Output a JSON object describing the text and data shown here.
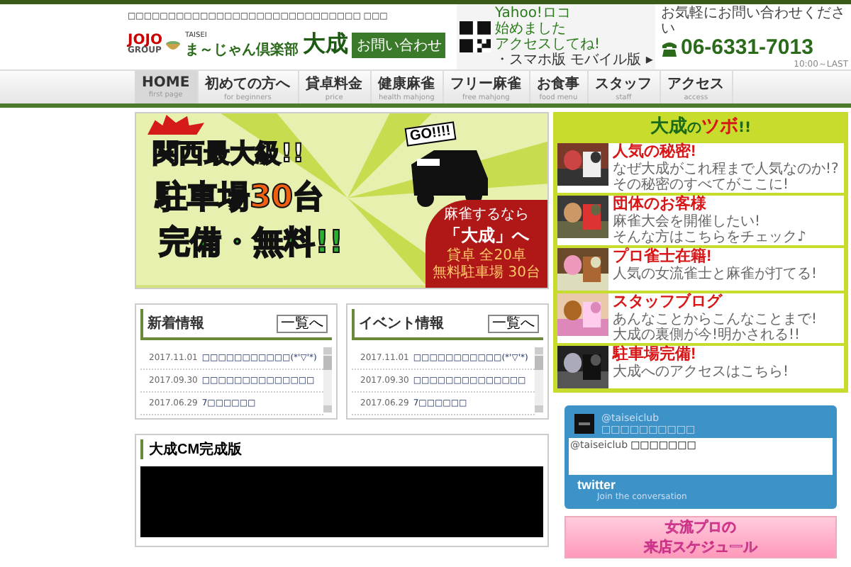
{
  "header": {
    "top_text": "□□□□□□□□□□□□□□□□□□□□□□□□□□□□□ □□□",
    "logo": "JOJO",
    "logo_sub": "GROUP",
    "brand_small": "TAISEI",
    "brand": "ま～じゃん倶楽部",
    "brand_big": "大成",
    "contact_button": "お問い合わせ",
    "yahoo_lines": [
      "Yahoo!ロコ",
      "始めました",
      "アクセスしてね!"
    ],
    "mobile_link": "・スマホ版 モバイル版 ▸",
    "phone_note": "お気軽にお問い合わせください",
    "phone": "06-6331-7013",
    "hours": "10:00～LAST"
  },
  "nav": [
    {
      "label": "HOME",
      "sub": "first page",
      "selected": true
    },
    {
      "label": "初めての方へ",
      "sub": "for beginners",
      "selected": false
    },
    {
      "label": "貸卓料金",
      "sub": "price",
      "selected": false
    },
    {
      "label": "健康麻雀",
      "sub": "health mahjong",
      "selected": false
    },
    {
      "label": "フリー麻雀",
      "sub": "free mahjong",
      "selected": false
    },
    {
      "label": "お食事",
      "sub": "food menu",
      "selected": false
    },
    {
      "label": "スタッフ",
      "sub": "staff",
      "selected": false
    },
    {
      "label": "アクセス",
      "sub": "access",
      "selected": false
    }
  ],
  "banner": {
    "headline_1": "関西最大級!!",
    "headline_2": "駐車場30台",
    "headline_3": "完備・無料!!",
    "go": "GO!!!!",
    "badge_1": "麻雀するなら",
    "badge_2": "「大成」へ",
    "info_1": "貸卓 全20卓",
    "info_2": "無料駐車場 30台"
  },
  "tsubo": {
    "title": "大成",
    "title_mid": "の",
    "title_end": "ツボ",
    "title_mark": "!!",
    "items": [
      {
        "title": "人気の秘密!",
        "lines": [
          "なぜ大成がこれ程まで人気なのか!?",
          "その秘密のすべてがここに!"
        ]
      },
      {
        "title": "団体のお客様",
        "lines": [
          "麻雀大会を開催したい!",
          "そんな方はこちらをチェック♪"
        ]
      },
      {
        "title": "プロ雀士在籍!",
        "lines": [
          "人気の女流雀士と麻雀が打てる!"
        ]
      },
      {
        "title": "スタッフブログ",
        "lines": [
          "あんなことからこんなことまで!",
          "大成の裏側が今!明かされる!!"
        ]
      },
      {
        "title": "駐車場完備!",
        "lines": [
          "大成へのアクセスはこちら!"
        ]
      }
    ]
  },
  "news": [
    {
      "title": "新着情報",
      "more": "一覧へ",
      "items": [
        {
          "date": "2017.11.01",
          "text": "□□□□□□□□□□□(*'▽'*)"
        },
        {
          "date": "2017.09.30",
          "text": "□□□□□□□□□□□□□□"
        },
        {
          "date": "2017.06.29",
          "text": "7□□□□□□"
        }
      ]
    },
    {
      "title": "イベント情報",
      "more": "一覧へ",
      "items": [
        {
          "date": "2017.11.01",
          "text": "□□□□□□□□□□□(*'▽'*)"
        },
        {
          "date": "2017.09.30",
          "text": "□□□□□□□□□□□□□□"
        },
        {
          "date": "2017.06.29",
          "text": "7□□□□□□"
        }
      ]
    }
  ],
  "twitter": {
    "handle": "@taiseiclub",
    "name": "□□□□□□□□□□",
    "tweet_user": "@taiseiclub",
    "tweet_text": "□□□□□□□",
    "logo": "twitter",
    "join": "Join the conversation"
  },
  "cm": {
    "title": "大成CM完成版"
  },
  "side_banner": {
    "lines": [
      "女流プロの",
      "来店スケジュール"
    ]
  }
}
